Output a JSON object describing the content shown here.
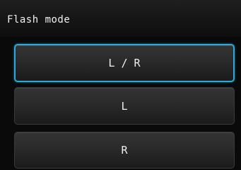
{
  "screen": {
    "title": "Flash mode"
  },
  "options": [
    {
      "label": "L / R",
      "selected": true
    },
    {
      "label": "L",
      "selected": false
    },
    {
      "label": "R",
      "selected": false
    }
  ],
  "colors": {
    "selection_highlight": "#2fa9d8",
    "background": "#0a0a0a",
    "text": "#f0f0f0"
  }
}
